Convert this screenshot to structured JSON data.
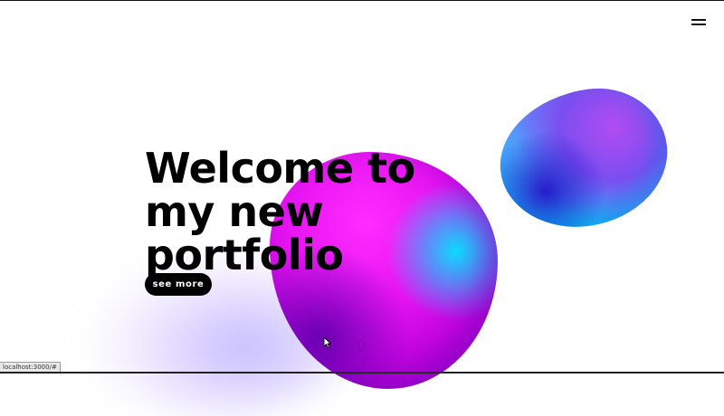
{
  "hero": {
    "title_lines": [
      "Welcome to",
      "my new",
      "portfolio"
    ],
    "cta_label": "see more"
  },
  "header": {
    "menu_icon": "hamburger-icon"
  },
  "status_bar": {
    "url": "localhost:3000/#"
  },
  "decor": {
    "pink_blob_colors": [
      "#ff2cff",
      "#b400d6",
      "#00e6ff"
    ],
    "blue_blob_colors": [
      "#8a5cf2",
      "#4aa8ff",
      "#1a14c8"
    ],
    "accent": "#000000"
  }
}
